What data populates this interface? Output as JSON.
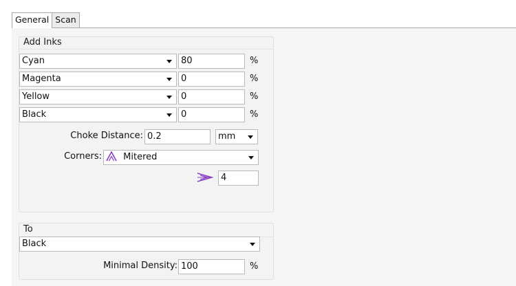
{
  "tabs": [
    {
      "label": "General",
      "active": true
    },
    {
      "label": "Scan",
      "active": false
    }
  ],
  "add_inks": {
    "title": "Add Inks",
    "rows": [
      {
        "ink": "Cyan",
        "value": "80",
        "unit": "%"
      },
      {
        "ink": "Magenta",
        "value": "0",
        "unit": "%"
      },
      {
        "ink": "Yellow",
        "value": "0",
        "unit": "%"
      },
      {
        "ink": "Black",
        "value": "0",
        "unit": "%"
      }
    ],
    "choke_distance": {
      "label": "Choke Distance:",
      "value": "0.2",
      "unit": "mm"
    },
    "corners": {
      "label": "Corners:",
      "value": "Mitered",
      "icon": "mitered-corner-icon"
    },
    "miter_limit": {
      "icon": "miter-limit-icon",
      "value": "4"
    }
  },
  "to": {
    "title": "To",
    "ink": "Black",
    "minimal_density": {
      "label": "Minimal Density:",
      "value": "100",
      "unit": "%"
    }
  },
  "colors": {
    "icon_purple": "#8a3fc4",
    "pane_bg": "#f5f5f5"
  }
}
